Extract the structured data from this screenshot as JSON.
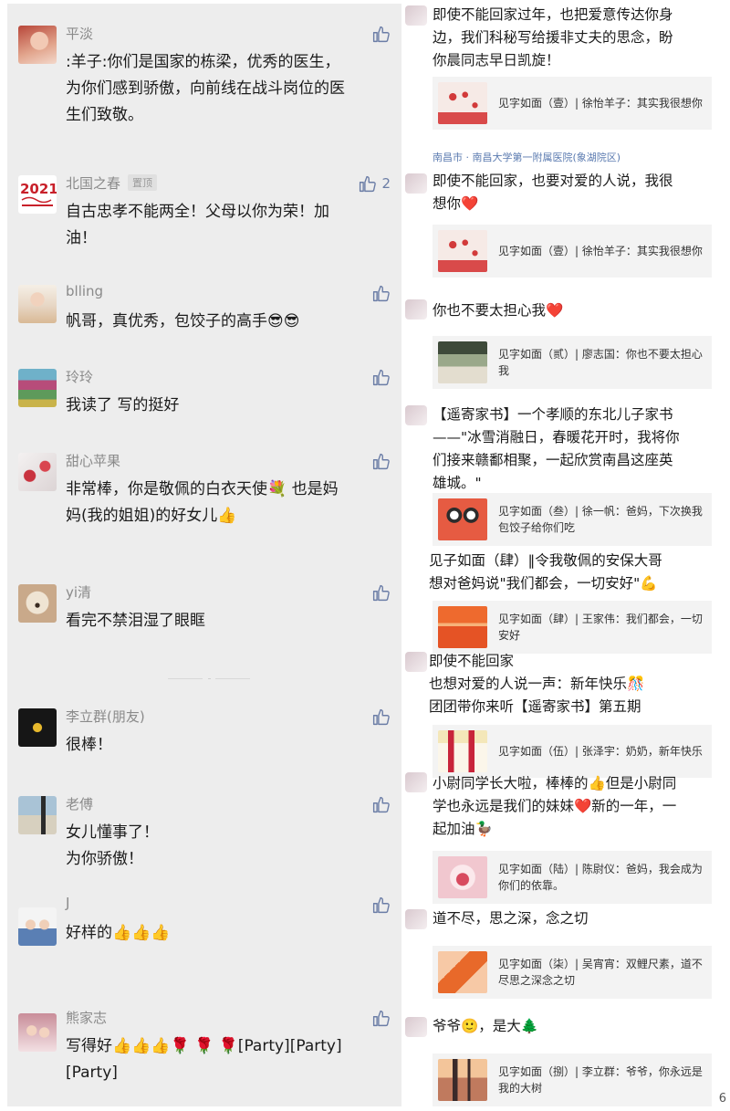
{
  "left_comments": [
    {
      "name": "平淡",
      "tag": "",
      "likes": "",
      "lines": [
        ":羊子:你们是国家的栋梁，优秀的医生，",
        "为你们感到骄傲，向前线在战斗岗位的医",
        "生们致敬。"
      ],
      "avatar": "woman-red-hair"
    },
    {
      "name": "北国之春",
      "tag": "置顶",
      "likes": "2",
      "lines": [
        "自古忠孝不能两全！父母以你为荣！加",
        "油！"
      ],
      "avatar": "logo-2021-red"
    },
    {
      "name": "blling",
      "tag": "",
      "likes": "",
      "lines": [
        "帆哥，真优秀，包饺子的高手😎😎"
      ],
      "avatar": "girl-portrait"
    },
    {
      "name": "玲玲",
      "tag": "",
      "likes": "",
      "lines": [
        "我读了 写的挺好"
      ],
      "avatar": "flowers-scene"
    },
    {
      "name": "甜心苹果",
      "tag": "",
      "likes": "",
      "lines": [
        "非常棒，你是敬佩的白衣天使💐 也是妈",
        "妈(我的姐姐)的好女儿👍"
      ],
      "avatar": "white-red-flowers"
    },
    {
      "name": "yi清",
      "tag": "",
      "likes": "",
      "lines": [
        "看完不禁泪湿了眼眶"
      ],
      "avatar": "puppy"
    },
    {
      "name": "李立群(朋友)",
      "tag": "",
      "likes": "",
      "lines": [
        "很棒！"
      ],
      "avatar": "dark-yellow-flower"
    },
    {
      "name": "老傅",
      "tag": "",
      "likes": "",
      "lines": [
        "女儿懂事了！",
        "为你骄傲！"
      ],
      "avatar": "man-beach"
    },
    {
      "name": "J",
      "tag": "",
      "likes": "",
      "lines": [
        "好样的👍👍👍"
      ],
      "avatar": "two-people"
    },
    {
      "name": "熊家志",
      "tag": "",
      "likes": "",
      "lines": [
        "写得好👍👍👍🌹 🌹 🌹[Party][Party]",
        "[Party]"
      ],
      "avatar": "two-women"
    }
  ],
  "right_items": [
    {
      "lines": [
        "即使不能回家过年，也把爱意传达你身",
        "边，我们科秘写给援非丈夫的思念，盼",
        "你晨同志早日凯旋！"
      ],
      "card": "见字如面（壹）| 徐怡羊子：其实我很想你",
      "location": "南昌市 · 南昌大学第一附属医院(象湖院区)",
      "thumb": "red-dots"
    },
    {
      "lines": [
        "即使不能回家，也要对爱的人说，我很",
        "想你❤️"
      ],
      "card": "见字如面（壹）| 徐怡羊子：其实我很想你",
      "location": "",
      "thumb": "red-dots"
    },
    {
      "lines": [
        "你也不要太担心我❤️"
      ],
      "card": "见字如面（贰）| 廖志国：你也不要太担心我",
      "location": "",
      "thumb": "green-photo"
    },
    {
      "lines": [
        "【遥寄家书】一个孝顺的东北儿子家书",
        "——\"冰雪消融日，春暖花开时，我将你",
        "们接来赣鄱相聚，一起欣赏南昌这座英",
        "雄城。\""
      ],
      "card": "见字如面（叁）| 徐一帆：爸妈，下次换我包饺子给你们吃",
      "location": "",
      "thumb": "happy-red"
    },
    {
      "lines": [
        "见子如面（肆）‖令我敬佩的安保大哥",
        "想对爸妈说\"我们都会，一切安好\"💪"
      ],
      "card": "见字如面（肆）| 王家伟：我们都会，一切安好",
      "location": "",
      "thumb": "orange-red"
    },
    {
      "lines": [
        "即使不能回家",
        "也想对爱的人说一声：新年快乐🎊",
        "团团带你来听【遥寄家书】第五期"
      ],
      "card": "见字如面（伍）| 张泽宇：奶奶，新年快乐",
      "location": "",
      "thumb": "paper-cut"
    },
    {
      "lines": [
        "小尉同学长大啦，棒棒的👍但是小尉同",
        "学也永远是我们的妹妹❤️新的一年，一",
        "起加油🦆"
      ],
      "card": "见字如面（陆）| 陈尉仪：爸妈，我会成为你们的依靠。",
      "location": "",
      "thumb": "2021-pink"
    },
    {
      "lines": [
        "道不尽，思之深，念之切"
      ],
      "card": "见字如面（柒）| 吴宵宵：双鲤尺素，道不尽思之深念之切",
      "location": "",
      "thumb": "orange-card"
    },
    {
      "lines": [
        "爷爷🙂，是大🌲"
      ],
      "card": "见字如面（捌）| 李立群：爷爷，你永远是我的大树",
      "location": "",
      "thumb": "sunset-silhouette"
    }
  ],
  "edge_char": "6"
}
